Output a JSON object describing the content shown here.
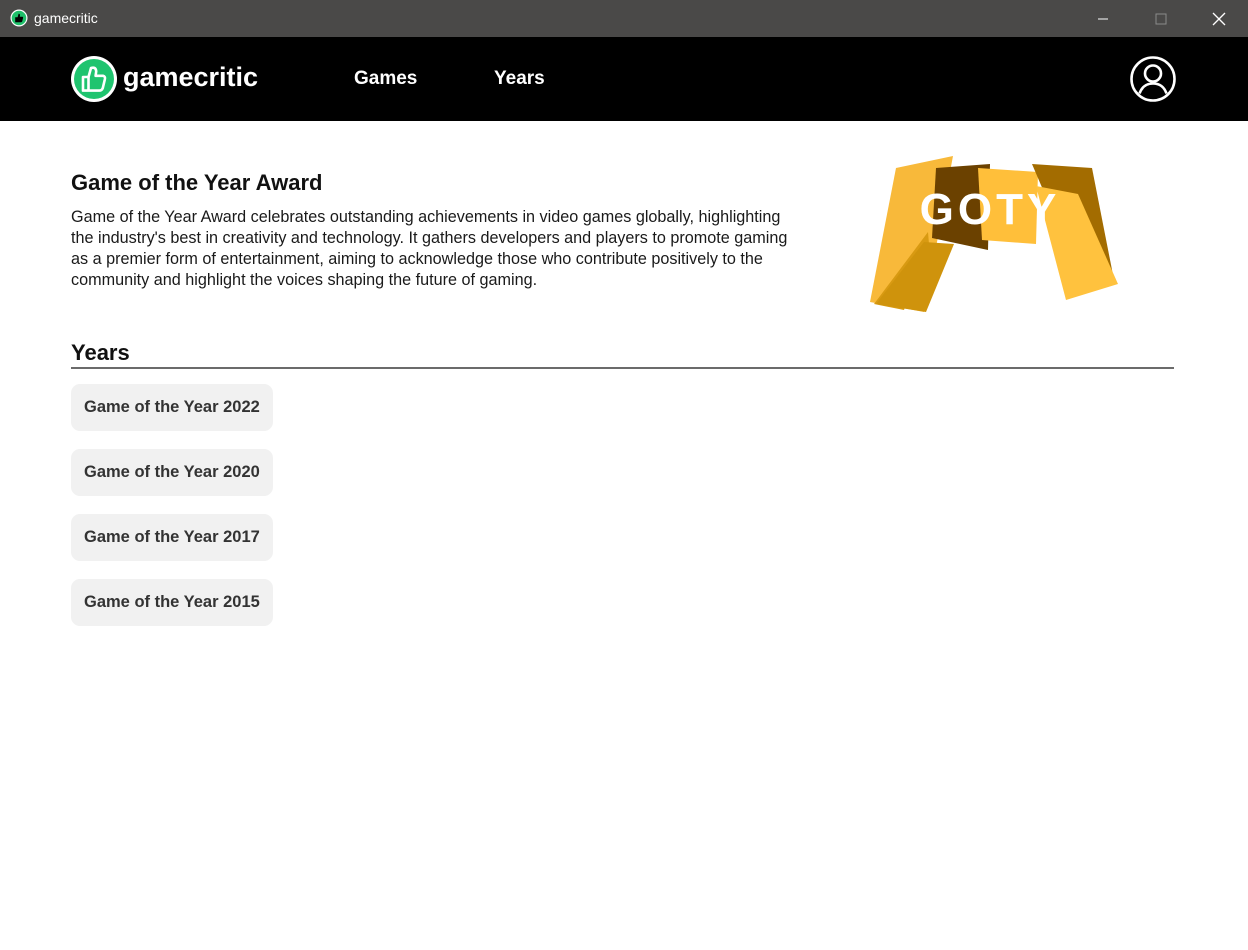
{
  "window": {
    "title": "gamecritic"
  },
  "header": {
    "logo_text": "gamecritic",
    "nav": [
      {
        "label": "Games"
      },
      {
        "label": "Years"
      }
    ]
  },
  "award": {
    "title": "Game of the Year Award",
    "description": "Game of the Year Award celebrates outstanding achievements in video games globally, highlighting the industry's best in creativity and technology. It gathers developers and players to promote gaming as a premier form of entertainment, aiming to acknowledge those who contribute positively to the community and highlight the voices shaping the future of gaming.",
    "logo_text": "GOTY"
  },
  "years_section": {
    "heading": "Years",
    "items": [
      {
        "label": "Game of the Year 2022"
      },
      {
        "label": "Game of the Year 2020"
      },
      {
        "label": "Game of the Year 2017"
      },
      {
        "label": "Game of the Year 2015"
      }
    ]
  },
  "colors": {
    "brand_green": "#2ecc71",
    "goty_gold": "#f4b942",
    "goty_dark": "#7a4a00"
  }
}
